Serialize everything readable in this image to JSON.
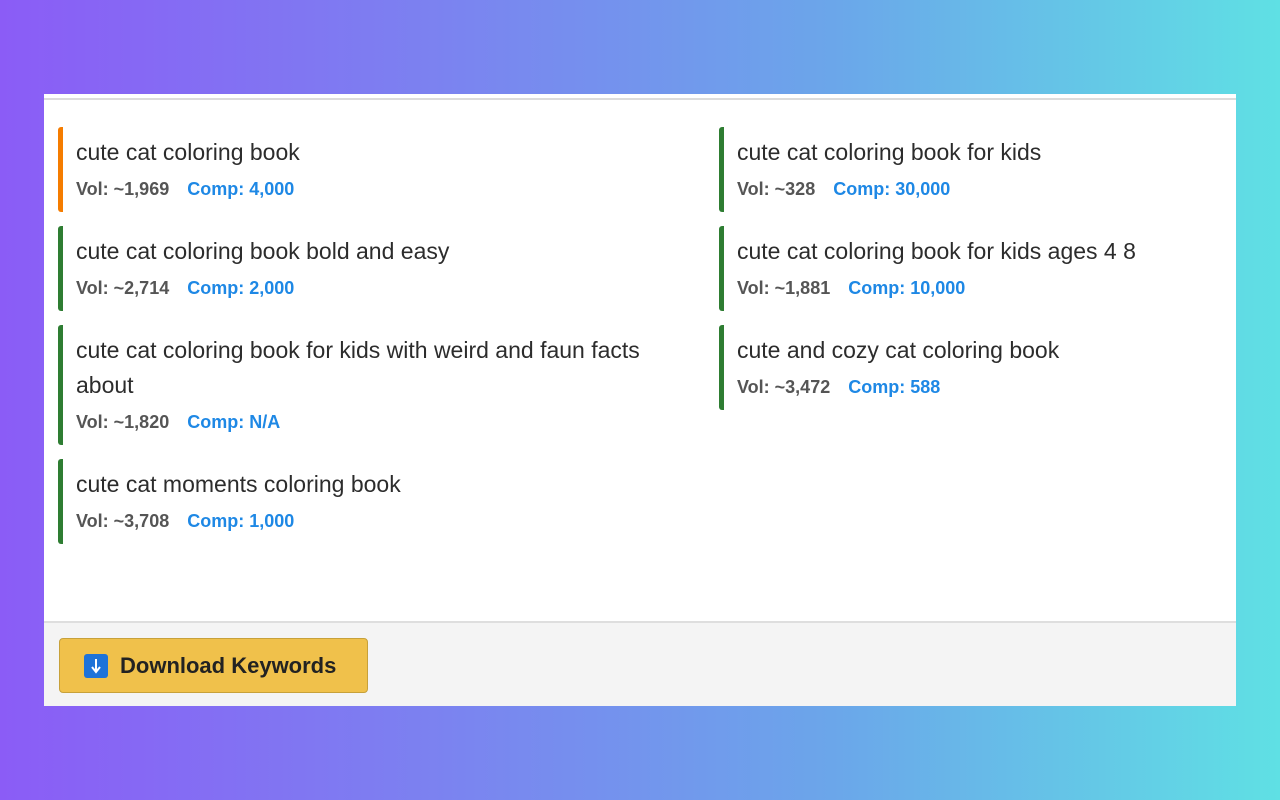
{
  "keywords": {
    "left": [
      {
        "title": "cute cat coloring book",
        "vol": "Vol: ~1,969",
        "comp": "Comp: 4,000",
        "status_color": "#f57c00"
      },
      {
        "title": "cute cat coloring book bold and easy",
        "vol": "Vol: ~2,714",
        "comp": "Comp: 2,000",
        "status_color": "#2e7d32"
      },
      {
        "title": "cute cat coloring book for kids with weird and faun facts about",
        "vol": "Vol: ~1,820",
        "comp": "Comp: N/A",
        "status_color": "#2e7d32"
      },
      {
        "title": "cute cat moments coloring book",
        "vol": "Vol: ~3,708",
        "comp": "Comp: 1,000",
        "status_color": "#2e7d32"
      }
    ],
    "right": [
      {
        "title": "cute cat coloring book for kids",
        "vol": "Vol: ~328",
        "comp": "Comp: 30,000",
        "status_color": "#2e7d32"
      },
      {
        "title": "cute cat coloring book for kids ages 4 8",
        "vol": "Vol: ~1,881",
        "comp": "Comp: 10,000",
        "status_color": "#2e7d32"
      },
      {
        "title": "cute and cozy cat coloring book",
        "vol": "Vol: ~3,472",
        "comp": "Comp: 588",
        "status_color": "#2e7d32"
      }
    ]
  },
  "footer": {
    "download_label": "Download Keywords",
    "download_icon": "download-arrow-icon"
  },
  "colors": {
    "accent_blue": "#1e88e5",
    "button_yellow": "#f0c14b",
    "status_green": "#2e7d32",
    "status_orange": "#f57c00"
  }
}
